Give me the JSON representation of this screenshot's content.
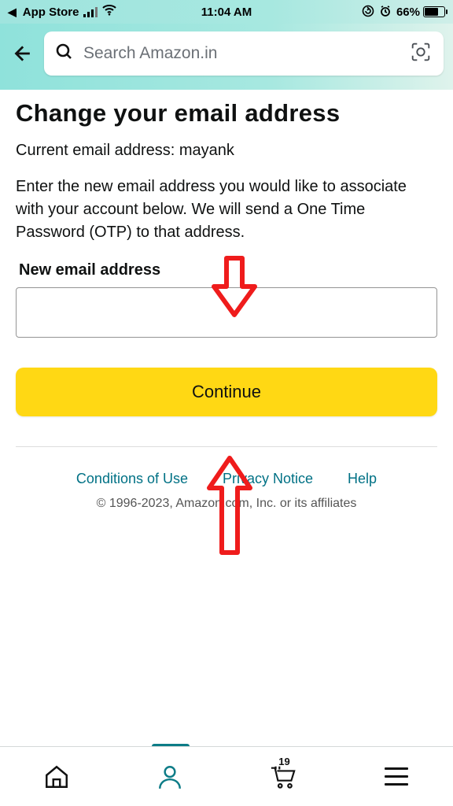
{
  "status": {
    "back_app": "App Store",
    "time": "11:04 AM",
    "battery_pct": "66%"
  },
  "header": {
    "search_placeholder": "Search Amazon.in"
  },
  "page": {
    "title": "Change your email address",
    "current_label": "Current email address:",
    "current_value": "mayank",
    "instructions": "Enter the new email address you would like to associate with your account below. We will send a One Time Password (OTP) to that address.",
    "new_label": "New email address",
    "new_value": "",
    "continue": "Continue"
  },
  "footer": {
    "links": [
      "Conditions of Use",
      "Privacy Notice",
      "Help"
    ],
    "copyright": "© 1996-2023, Amazon.com, Inc. or its affiliates"
  },
  "tabs": {
    "cart_count": "19"
  }
}
